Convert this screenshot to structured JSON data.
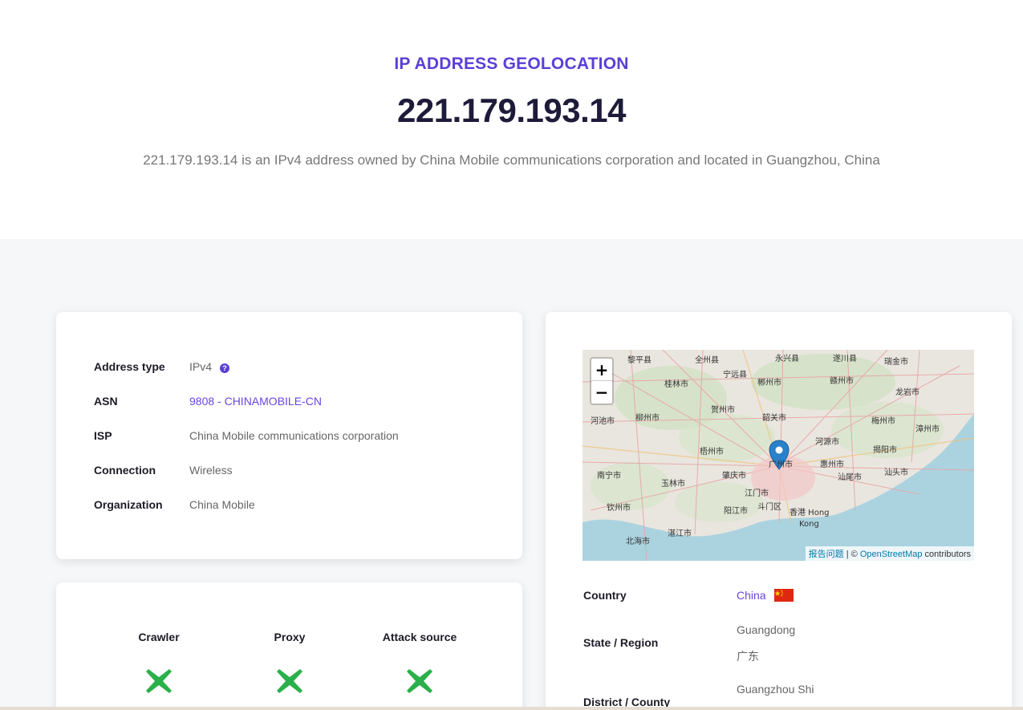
{
  "hero": {
    "eyebrow": "IP ADDRESS GEOLOCATION",
    "ip": "221.179.193.14",
    "summary": "221.179.193.14 is an IPv4 address owned by China Mobile communications corporation and located in Guangzhou, China"
  },
  "details": {
    "address_type": {
      "label": "Address type",
      "value": "IPv4",
      "help_icon": "question-circle-icon"
    },
    "asn": {
      "label": "ASN",
      "value": "9808 - CHINAMOBILE-CN"
    },
    "isp": {
      "label": "ISP",
      "value": "China Mobile communications corporation"
    },
    "connection": {
      "label": "Connection",
      "value": "Wireless"
    },
    "organization": {
      "label": "Organization",
      "value": "China Mobile"
    }
  },
  "flags": [
    {
      "label": "Crawler",
      "icon": "cross-icon"
    },
    {
      "label": "Proxy",
      "icon": "cross-icon"
    },
    {
      "label": "Attack source",
      "icon": "cross-icon"
    }
  ],
  "map": {
    "zoom_in": "+",
    "zoom_out": "−",
    "attribution_report": "报告问题",
    "attribution_sep": " | © ",
    "attribution_osm": "OpenStreetMap",
    "attribution_suffix": " contributors",
    "labels": [
      "黎平县",
      "全州县",
      "永兴县",
      "遂川县",
      "瑞金市",
      "郴州市",
      "赣州市",
      "桂林市",
      "宁远县",
      "龙岩市",
      "河池市",
      "柳州市",
      "贺州市",
      "韶关市",
      "梅州市",
      "漳州市",
      "河源市",
      "揭阳市",
      "梧州市",
      "汕头市",
      "南宁市",
      "玉林市",
      "肇庆市",
      "广州市",
      "惠州市",
      "汕尾市",
      "江门市",
      "香港 Hong Kong",
      "钦州市",
      "湛江市",
      "北海市",
      "阳江市",
      "斗门区"
    ]
  },
  "location": {
    "country": {
      "label": "Country",
      "value": "China",
      "flag_icon": "china-flag-icon"
    },
    "region": {
      "label": "State / Region",
      "value": "Guangdong",
      "value_local": "广东"
    },
    "district": {
      "label": "District / County",
      "value": "Guangzhou Shi"
    }
  },
  "colors": {
    "accent": "#5b3fd6",
    "cross": "#2ab04a",
    "sea": "#aad3df",
    "land": "#e9e6df"
  }
}
